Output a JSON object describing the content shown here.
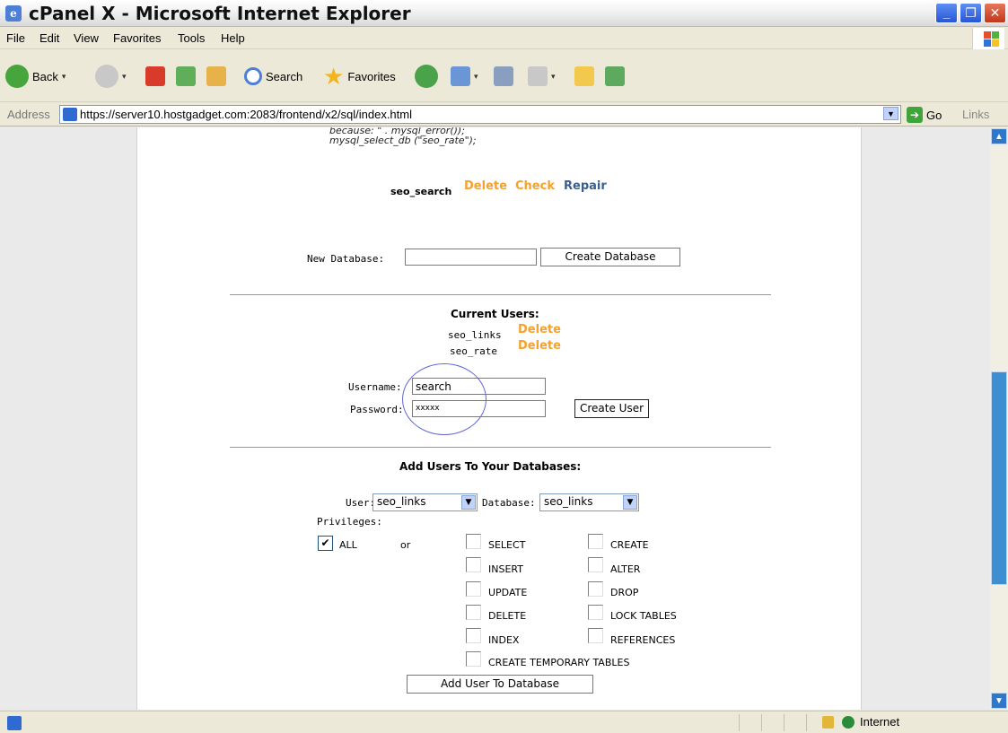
{
  "window": {
    "title": "cPanel X - Microsoft Internet Explorer"
  },
  "menu": [
    "File",
    "Edit",
    "View",
    "Favorites",
    "Tools",
    "Help"
  ],
  "toolbar": {
    "back_label": "Back",
    "search_label": "Search",
    "favorites_label": "Favorites"
  },
  "address": {
    "label": "Address",
    "url": "https://server10.hostgadget.com:2083/frontend/x2/sql/index.html",
    "go_label": "Go",
    "links_label": "Links"
  },
  "page": {
    "code_lines": [
      "because: \" . mysql_error());",
      "mysql_select_db (\"seo_rate\");"
    ],
    "db_row": {
      "name": "seo_search",
      "delete": "Delete",
      "check": "Check",
      "repair": "Repair"
    },
    "new_db": {
      "label": "New Database:",
      "value": "",
      "button": "Create Database"
    },
    "current_users": {
      "heading": "Current Users:",
      "users": [
        {
          "name": "seo_links",
          "delete": "Delete"
        },
        {
          "name": "seo_rate",
          "delete": "Delete"
        }
      ]
    },
    "create_user": {
      "username_label": "Username:",
      "username_value": "search",
      "password_label": "Password:",
      "password_value": "xxxxx",
      "button": "Create User"
    },
    "add_users": {
      "heading": "Add Users To Your Databases:",
      "user_label": "User:",
      "user_selected": "seo_links",
      "db_label": "Database:",
      "db_selected": "seo_links",
      "privileges_label": "Privileges:",
      "all_label": "ALL",
      "or_label": "or",
      "privileges_left": [
        "SELECT",
        "INSERT",
        "UPDATE",
        "DELETE",
        "INDEX",
        "CREATE TEMPORARY TABLES"
      ],
      "privileges_right": [
        "CREATE",
        "ALTER",
        "DROP",
        "LOCK TABLES",
        "REFERENCES"
      ],
      "button": "Add User To Database"
    }
  },
  "status": {
    "zone": "Internet"
  }
}
